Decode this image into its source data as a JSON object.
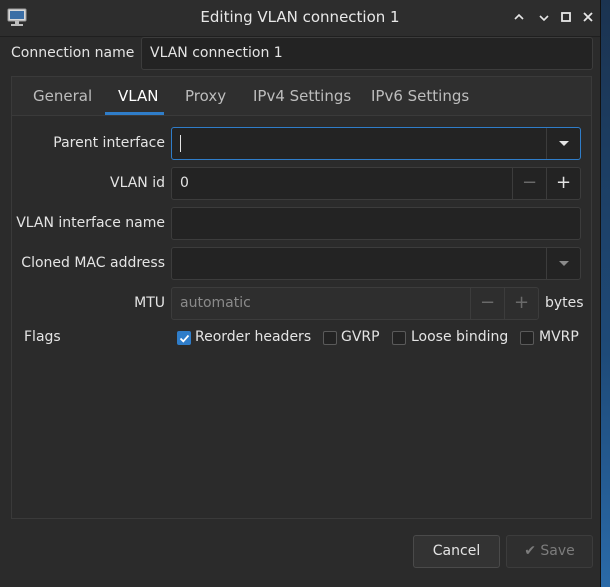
{
  "window": {
    "title": "Editing VLAN connection 1"
  },
  "connection_name": {
    "label": "Connection name",
    "value": "VLAN connection 1"
  },
  "tabs": [
    {
      "label": "General"
    },
    {
      "label": "VLAN"
    },
    {
      "label": "Proxy"
    },
    {
      "label": "IPv4 Settings"
    },
    {
      "label": "IPv6 Settings"
    }
  ],
  "active_tab": "VLAN",
  "vlan": {
    "parent_interface": {
      "label": "Parent interface",
      "value": ""
    },
    "vlan_id": {
      "label": "VLAN id",
      "value": "0"
    },
    "vlan_interface_name": {
      "label": "VLAN interface name",
      "value": ""
    },
    "cloned_mac": {
      "label": "Cloned MAC address",
      "value": ""
    },
    "mtu": {
      "label": "MTU",
      "placeholder": "automatic",
      "unit": "bytes"
    },
    "flags": {
      "label": "Flags",
      "items": [
        {
          "label": "Reorder headers",
          "checked": true
        },
        {
          "label": "GVRP",
          "checked": false
        },
        {
          "label": "Loose binding",
          "checked": false
        },
        {
          "label": "MVRP",
          "checked": false
        }
      ]
    }
  },
  "buttons": {
    "cancel": "Cancel",
    "save": "Save"
  },
  "colors": {
    "accent": "#2f7dc9",
    "window_bg": "#2b2b2b",
    "desktop_bg": "#1d3a5c"
  }
}
